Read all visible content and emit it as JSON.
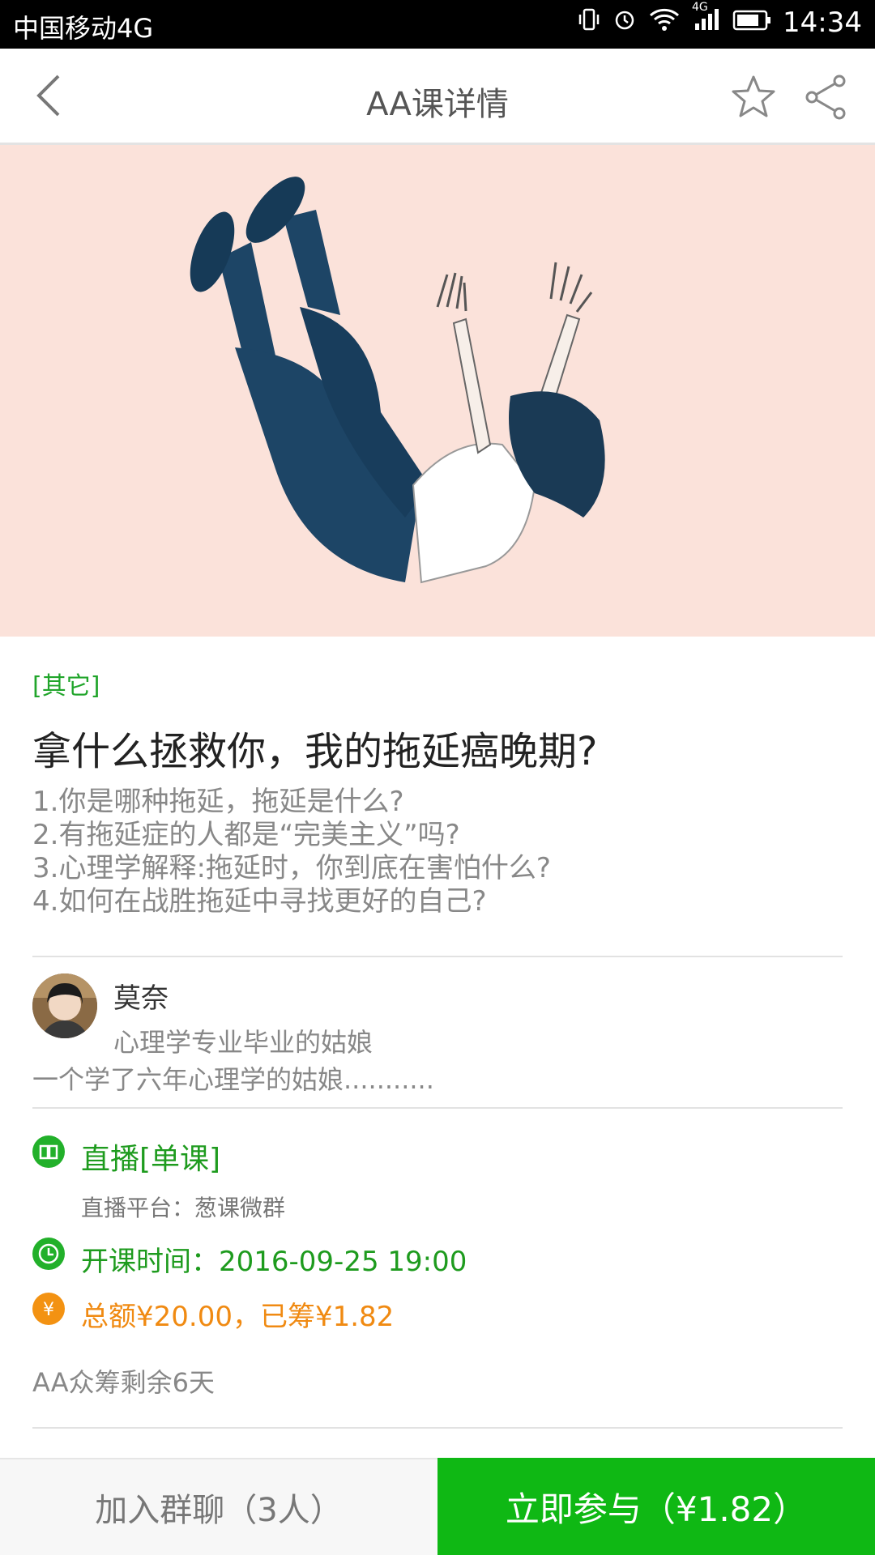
{
  "status_bar": {
    "carrier": "中国移动4G",
    "network_label": "4G",
    "time": "14:34"
  },
  "nav": {
    "title": "AA课详情"
  },
  "hero_image": {
    "description_icon": "falling-person-illustration",
    "background_color": "#fbe2da"
  },
  "course": {
    "category": "[其它]",
    "title": "拿什么拯救你，我的拖延癌晚期?",
    "outline": [
      "1.你是哪种拖延，拖延是什么?",
      "2.有拖延症的人都是“完美主义”吗?",
      "3.心理学解释:拖延时，你到底在害怕什么?",
      "4.如何在战胜拖延中寻找更好的自己?"
    ]
  },
  "author": {
    "name": "莫奈",
    "bio_line1": "心理学专业毕业的姑娘",
    "bio_line2": "一个学了六年心理学的姑娘..........."
  },
  "info": {
    "type_label": "直播[单课]",
    "platform": "直播平台：葱课微群",
    "start_time": "开课时间：2016-09-25 19:00",
    "funding": "总额¥20.00，已筹¥1.82",
    "remaining": "AA众筹剩余6天"
  },
  "actions": {
    "join_group": "加入群聊（3人）",
    "participate": "立即参与（¥1.82）"
  },
  "colors": {
    "accent_green": "#0fb814",
    "text_green": "#1e9b1e",
    "orange": "#f08a12"
  }
}
